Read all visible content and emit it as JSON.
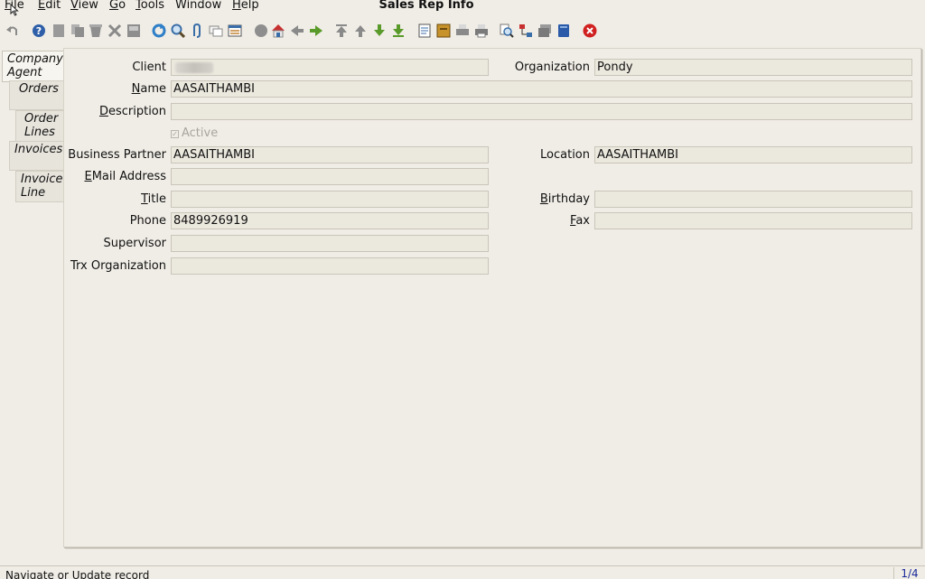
{
  "menu": {
    "items": [
      {
        "name": "menu-file",
        "mnemonic": "F",
        "rest": "ile"
      },
      {
        "name": "menu-edit",
        "mnemonic": "E",
        "rest": "dit"
      },
      {
        "name": "menu-view",
        "mnemonic": "V",
        "rest": "iew"
      },
      {
        "name": "menu-go",
        "mnemonic": "G",
        "rest": "o"
      },
      {
        "name": "menu-tools",
        "mnemonic": "T",
        "rest": "ools"
      },
      {
        "name": "menu-window",
        "mnemonic": "",
        "rest": "Window"
      },
      {
        "name": "menu-help",
        "mnemonic": "H",
        "rest": "elp"
      }
    ]
  },
  "window": {
    "title": "Sales Rep Info"
  },
  "tabs": [
    {
      "line1": "Company",
      "line2": "Agent",
      "active": true
    },
    {
      "line1": "Orders",
      "line2": "",
      "active": false
    },
    {
      "line1": "Order",
      "line2": "Lines",
      "active": false
    },
    {
      "line1": "Invoices",
      "line2": "",
      "active": false
    },
    {
      "line1": "Invoice",
      "line2": "Line",
      "active": false
    }
  ],
  "form": {
    "client": {
      "label": "Client",
      "value": ""
    },
    "organization": {
      "label": "Organization",
      "value": "Pondy"
    },
    "name": {
      "label_mn": "N",
      "label_rest": "ame",
      "value": "AASAITHAMBI"
    },
    "description": {
      "label_mn": "D",
      "label_rest": "escription",
      "value": ""
    },
    "active": {
      "label": "Active",
      "checked": true
    },
    "business_partner": {
      "label": "Business Partner",
      "value": "AASAITHAMBI"
    },
    "location": {
      "label": "Location",
      "value": "AASAITHAMBI"
    },
    "email": {
      "label_mn": "E",
      "label_rest": "Mail Address",
      "value": ""
    },
    "title": {
      "label_mn": "T",
      "label_rest": "itle",
      "value": ""
    },
    "birthday": {
      "label_mn": "B",
      "label_rest": "irthday",
      "value": ""
    },
    "phone": {
      "label": "Phone",
      "value": "8489926919"
    },
    "fax": {
      "label_mn": "F",
      "label_rest": "ax",
      "value": ""
    },
    "supervisor": {
      "label": "Supervisor",
      "value": ""
    },
    "trx_org": {
      "label": "Trx Organization",
      "value": ""
    }
  },
  "status": {
    "text": "Navigate or Update record",
    "record": "1/4"
  },
  "toolbar": {
    "icons": [
      "undo-icon",
      "help-icon",
      "new-record-icon",
      "copy-record-icon",
      "delete-icon",
      "delete-selection-icon",
      "save-icon",
      "refresh-icon",
      "find-icon",
      "attachment-icon",
      "chat-icon",
      "grid-toggle-icon",
      "history-icon",
      "home-icon",
      "back-icon",
      "forward-icon",
      "first-record-icon",
      "previous-record-icon",
      "next-record-icon",
      "last-record-icon",
      "report-icon",
      "archive-icon",
      "print-preview-icon",
      "print-icon",
      "zoom-across-icon",
      "workflow-icon",
      "request-icon",
      "product-info-icon",
      "exit-icon"
    ]
  }
}
